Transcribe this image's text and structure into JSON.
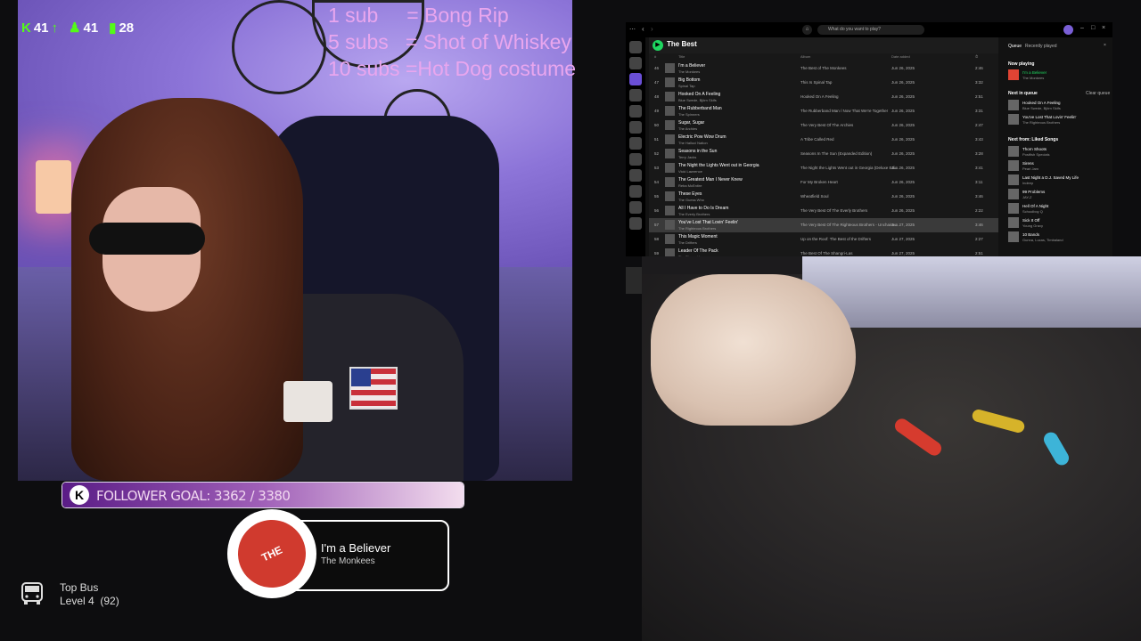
{
  "stats": {
    "kick_count": "41",
    "followers": "41",
    "viewers": "28"
  },
  "sub_goals": [
    "1 sub     = Bong Rip",
    "5 subs   = Shot of Whiskey",
    "10 subs =Hot Dog costume"
  ],
  "spotify": {
    "search_placeholder": "What do you want to play?",
    "playlist_title": "The Best",
    "columns": {
      "num": "#",
      "title": "Title",
      "album": "Album",
      "date": "Date added",
      "dur": "⏱"
    },
    "rows": [
      {
        "n": "46",
        "title": "I'm a Believer",
        "artist": "The Monkees",
        "album": "The Best of The Monkees",
        "date": "Jun 26, 2025",
        "dur": "2:46"
      },
      {
        "n": "47",
        "title": "Big Bottom",
        "artist": "Spinal Tap",
        "album": "This Is Spinal Tap",
        "date": "Jun 26, 2025",
        "dur": "3:32"
      },
      {
        "n": "48",
        "title": "Hooked On A Feeling",
        "artist": "Blue Swede, Björn Skifs",
        "album": "Hooked On A Feeling",
        "date": "Jun 26, 2025",
        "dur": "2:51"
      },
      {
        "n": "49",
        "title": "The Rubberband Man",
        "artist": "The Spinners",
        "album": "The Rubberband Man / Now That We're Together",
        "date": "Jun 26, 2025",
        "dur": "3:31"
      },
      {
        "n": "50",
        "title": "Sugar, Sugar",
        "artist": "The Archies",
        "album": "The Very Best Of The Archies",
        "date": "Jun 26, 2025",
        "dur": "2:47"
      },
      {
        "n": "51",
        "title": "Electric Pow Wow Drum",
        "artist": "The Halluci Nation",
        "album": "A Tribe Called Red",
        "date": "Jun 26, 2025",
        "dur": "3:43"
      },
      {
        "n": "52",
        "title": "Seasons in the Sun",
        "artist": "Terry Jacks",
        "album": "Seasons In The Sun (Expanded Edition)",
        "date": "Jun 26, 2025",
        "dur": "3:28"
      },
      {
        "n": "53",
        "title": "The Night the Lights Went out in Georgia",
        "artist": "Vicki Lawrence",
        "album": "The Night the Lights Went out in Georgia (Deluxe Edi...",
        "date": "Jun 26, 2025",
        "dur": "3:41"
      },
      {
        "n": "54",
        "title": "The Greatest Man I Never Knew",
        "artist": "Reba McEntire",
        "album": "For My Broken Heart",
        "date": "Jun 26, 2025",
        "dur": "3:11"
      },
      {
        "n": "55",
        "title": "These Eyes",
        "artist": "The Guess Who",
        "album": "Wheatfield Soul",
        "date": "Jun 26, 2025",
        "dur": "3:46"
      },
      {
        "n": "56",
        "title": "All I Have to Do Is Dream",
        "artist": "The Everly Brothers",
        "album": "The Very Best Of The Everly Brothers",
        "date": "Jun 26, 2025",
        "dur": "2:22"
      },
      {
        "n": "57",
        "title": "You've Lost That Lovin' Feelin'",
        "artist": "The Righteous Brothers",
        "album": "The Very Best Of The Righteous Brothers - Unchaine...",
        "date": "Jun 27, 2025",
        "dur": "3:46"
      },
      {
        "n": "58",
        "title": "This Magic Moment",
        "artist": "The Drifters",
        "album": "Up on the Roof: The Best of the Drifters",
        "date": "Jun 27, 2025",
        "dur": "2:27"
      },
      {
        "n": "59",
        "title": "Leader Of The Pack",
        "artist": "The Shangri-Las",
        "album": "The Best Of The Shangri-Las",
        "date": "Jun 27, 2025",
        "dur": "2:51"
      }
    ],
    "queue": {
      "tab_queue": "Queue",
      "tab_recent": "Recently played",
      "now_playing_label": "Now playing",
      "now_playing": {
        "title": "I'm a Believer",
        "artist": "The Monkees"
      },
      "next_label": "Next in queue",
      "clear_label": "Clear queue",
      "next": [
        {
          "title": "Hooked On A Feeling",
          "artist": "Blue Swede, Björn Skifs"
        },
        {
          "title": "You've Lost That Lovin' Feelin'",
          "artist": "The Righteous Brothers"
        }
      ],
      "from_label": "Next from: Liked Songs",
      "from": [
        {
          "title": "Thorn Shoots",
          "artist": "Postfish Specials"
        },
        {
          "title": "Sirens",
          "artist": "Pearl Jam"
        },
        {
          "title": "Last Night a D.J. Saved My Life",
          "artist": "Indeep"
        },
        {
          "title": "99 Problems",
          "artist": "JAY-Z"
        },
        {
          "title": "Hell Of A Night",
          "artist": "Schoolboy Q"
        },
        {
          "title": "Sick It Off",
          "artist": "Young Gravy"
        },
        {
          "title": "10 Bands",
          "artist": "Gunna, Lucas, Timbaland"
        }
      ]
    }
  },
  "follower_goal": {
    "logo": "K",
    "text": "FOLLOWER GOAL: 3362 / 3380",
    "progress": 0.995
  },
  "now_playing": {
    "title": "I'm a Believer",
    "artist": "The Monkees",
    "art_text": "THE MONKEES"
  },
  "top_bus": {
    "title": "Top Bus",
    "level": "Level 4  (92)"
  },
  "colors": {
    "kick_green": "#53fc18",
    "spotify_green": "#1ed760",
    "goal_purple": "#5a1c86",
    "sub_text_pink": "#e9a6ee"
  }
}
